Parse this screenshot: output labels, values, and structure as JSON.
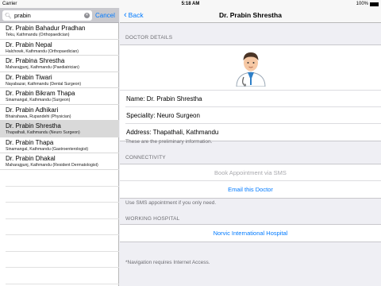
{
  "status": {
    "carrier": "Carrier",
    "time": "5:18 AM",
    "battery": "100%"
  },
  "search": {
    "value": "prabin",
    "cancel_label": "Cancel"
  },
  "doctors": [
    {
      "name": "Dr. Prabin Bahadur Pradhan",
      "detail": "Teku, Kathmandu   (Orthopaedician)"
    },
    {
      "name": "Dr. Prabin Nepal",
      "detail": "Halchowk, Kathmandu   (Orthopaedician)"
    },
    {
      "name": "Dr. Prabina Shrestha",
      "detail": "Maharajgunj, Kathmandu   (Paediatrician)"
    },
    {
      "name": "Dr. Prabin Tiwari",
      "detail": "Nayabazar, Kathmandu   (Dental Surgeon)"
    },
    {
      "name": "Dr. Prabin Bikram Thapa",
      "detail": "Sinamangal, Kathmandu   (Surgeon)"
    },
    {
      "name": "Dr. Prabin Adhikari",
      "detail": "Bhairahawa, Rupandehi   (Physician)"
    },
    {
      "name": "Dr. Prabin Shrestha",
      "detail": "Thapathali, Kathmandu   (Neuro Surgeon)"
    },
    {
      "name": "Dr. Prabin Thapa",
      "detail": "Sinamangal, Kathmandu   (Gastroenterologist)"
    },
    {
      "name": "Dr. Prabin Dhakal",
      "detail": "Maharajgunj, Kathmandu   (Resident Dermatologist)"
    }
  ],
  "selected_index": 6,
  "detail": {
    "back_label": "Back",
    "title": "Dr. Prabin Shrestha",
    "doctor_details_header": "DOCTOR DETAILS",
    "name_line": "Name:  Dr. Prabin Shrestha",
    "speciality_line": "Speciality:  Neuro Surgeon",
    "address_line": "Address:  Thapathali, Kathmandu",
    "preliminary_note": "These are the preliminary information.",
    "connectivity_header": "CONNECTIVITY",
    "sms_button": "Book Appointment via SMS",
    "email_button": "Email this Doctor",
    "sms_note": "Use SMS appointment if you only need.",
    "hospital_header": "WORKING HOSPITAL",
    "hospital_button": "Norvic International Hospital",
    "nav_note": "*Navigation requires Internet Access."
  },
  "colors": {
    "accent": "#007aff",
    "selected_row": "#d9d9d9",
    "disabled": "#a9a9ae"
  }
}
